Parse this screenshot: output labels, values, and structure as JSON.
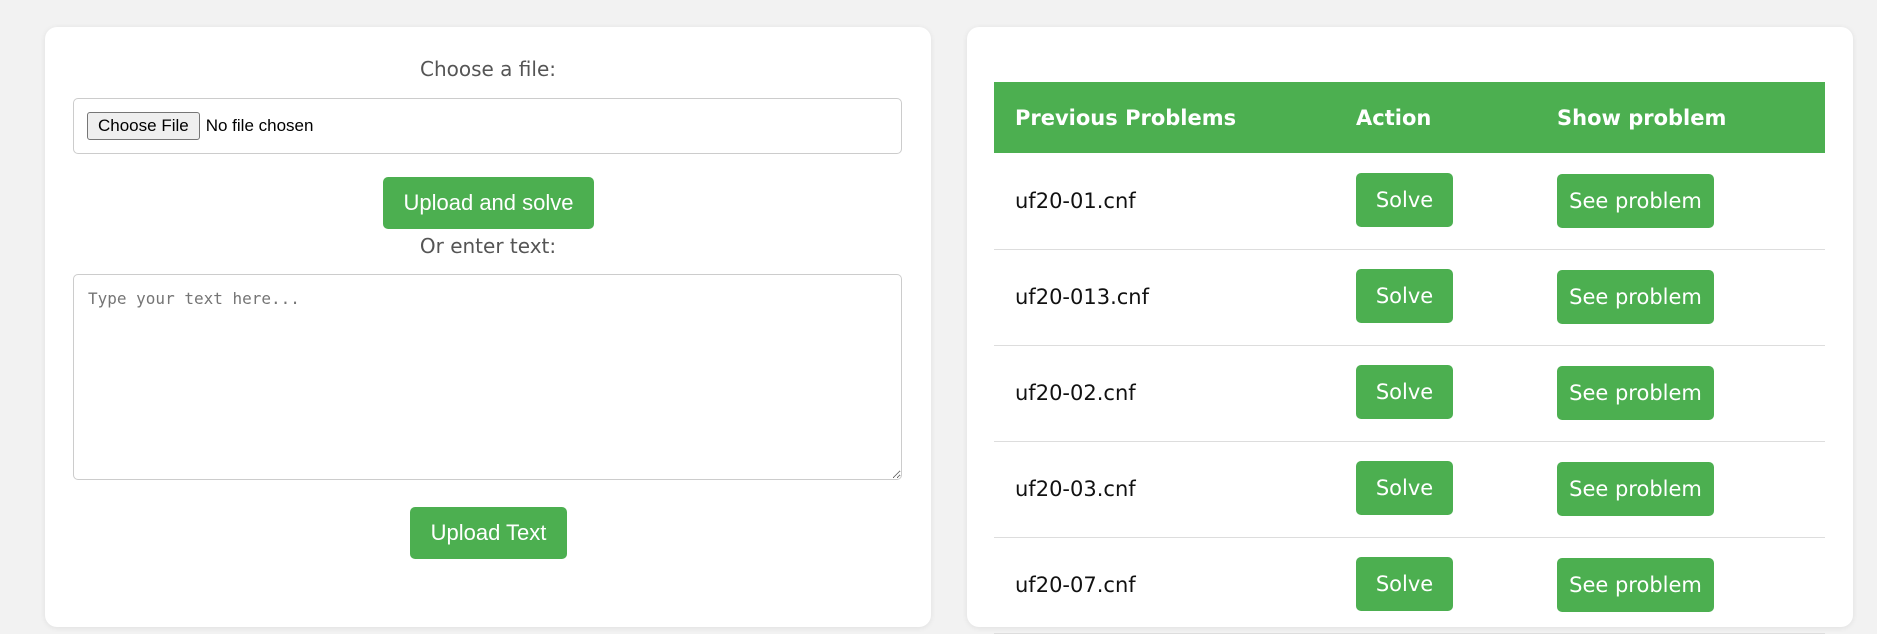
{
  "upload": {
    "file_label": "Choose a file:",
    "choose_file_button": "Choose File",
    "file_status": "No file chosen",
    "upload_solve_button": "Upload and solve",
    "text_label": "Or enter text:",
    "text_placeholder": "Type your text here...",
    "upload_text_button": "Upload Text"
  },
  "problems_table": {
    "headers": [
      "Previous Problems",
      "Action",
      "Show problem"
    ],
    "rows": [
      {
        "name": "uf20-01.cnf",
        "action": "Solve",
        "show": "See problem"
      },
      {
        "name": "uf20-013.cnf",
        "action": "Solve",
        "show": "See problem"
      },
      {
        "name": "uf20-02.cnf",
        "action": "Solve",
        "show": "See problem"
      },
      {
        "name": "uf20-03.cnf",
        "action": "Solve",
        "show": "See problem"
      },
      {
        "name": "uf20-07.cnf",
        "action": "Solve",
        "show": "See problem"
      }
    ]
  },
  "colors": {
    "accent": "#4caf50",
    "background": "#f2f2f2",
    "panel": "#ffffff"
  }
}
